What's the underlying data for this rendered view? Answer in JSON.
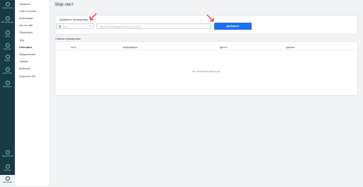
{
  "rail": {
    "items": [
      {
        "label": "Новые чаты",
        "icon": "chat-icon"
      },
      {
        "label": "Мессенджеры",
        "icon": "messenger-icon"
      },
      {
        "label": "Архив",
        "icon": "archive-icon"
      },
      {
        "label": "Воронка",
        "icon": "funnel-icon"
      },
      {
        "label": "Задачи",
        "icon": "tasks-icon"
      },
      {
        "label": "Аналитика",
        "icon": "analytics-icon"
      },
      {
        "label": "Партнерам",
        "icon": "partners-icon"
      }
    ],
    "bottom_items": [
      {
        "label": "Уведомления",
        "icon": "bell-icon"
      },
      {
        "label": "Помощь",
        "icon": "help-icon"
      },
      {
        "label": "Настройки",
        "icon": "settings-icon"
      }
    ]
  },
  "submenu": {
    "items": [
      "Профиль",
      "Сайт и сессия",
      "Интеграции",
      "Чат на сайт",
      "Операторы",
      "Теги",
      "Стоп-лист",
      "Уведомления",
      "Товары",
      "Шаблоны",
      "Открытое API"
    ],
    "active_index": 6
  },
  "page": {
    "title": "Stop-лист"
  },
  "add_block": {
    "title": "Добавить блокировку",
    "select_value": "Сhat",
    "input_placeholder": "https://www.instagram.com/p/CD_n4OJJ/",
    "button_label": "Добавить"
  },
  "list_block": {
    "title": "Список блокировок",
    "columns": [
      "Тип",
      "Информация",
      "Дата",
      "Удалить"
    ],
    "empty_text": "Нет активных фильтров"
  },
  "colors": {
    "rail": "#173a47",
    "accent": "#1f6ff0",
    "arrow": "#e0201c",
    "online": "#3dbb61"
  }
}
